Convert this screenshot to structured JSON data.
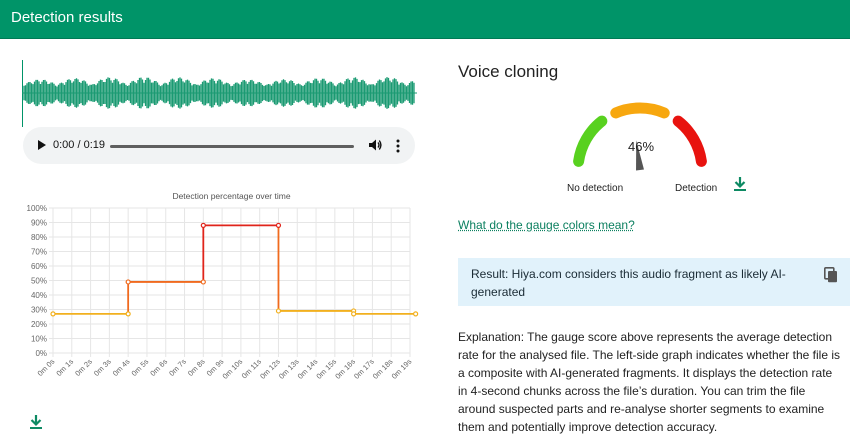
{
  "header": {
    "title": "Detection results"
  },
  "player": {
    "time": "0:00 / 0:19",
    "progress": 0
  },
  "icons": {
    "play": "play-icon",
    "volume": "volume-icon",
    "more": "more-vert-icon",
    "download": "download-icon",
    "copy": "copy-icon"
  },
  "colors": {
    "brand": "#009468",
    "waveform": "#1a9a72",
    "series_high": "#e0241b",
    "series_mid": "#f06a1e",
    "series_low": "#f2b01e",
    "result_bg": "#e1f2fb",
    "gauge_green": "#58d11f",
    "gauge_orange": "#f7a70f",
    "gauge_red": "#e8130f"
  },
  "chart_data": {
    "type": "line",
    "title": "Detection percentage over time",
    "xlabel": "",
    "ylabel": "",
    "ylim": [
      0,
      100
    ],
    "y_ticks": [
      "0%",
      "10%",
      "20%",
      "30%",
      "40%",
      "50%",
      "60%",
      "70%",
      "80%",
      "90%",
      "100%"
    ],
    "categories": [
      "0m 0s",
      "0m 1s",
      "0m 2s",
      "0m 3s",
      "0m 4s",
      "0m 5s",
      "0m 6s",
      "0m 7s",
      "0m 8s",
      "0m 9s",
      "0m 10s",
      "0m 11s",
      "0m 12s",
      "0m 13s",
      "0m 14s",
      "0m 15s",
      "0m 16s",
      "0m 17s",
      "0m 18s",
      "0m 19s"
    ],
    "grid": true,
    "series": [
      {
        "x": [
          0,
          4,
          4,
          8,
          8,
          12,
          12,
          16,
          16,
          19.3
        ],
        "values": [
          27,
          27,
          49,
          49,
          88,
          88,
          29,
          29,
          27,
          27
        ]
      }
    ]
  },
  "voice_cloning": {
    "title": "Voice cloning",
    "gauge_value": "46%",
    "gauge_level": 46,
    "label_left": "No detection",
    "label_right": "Detection",
    "link": "What do the gauge colors mean?",
    "result": "Result: Hiya.com considers this audio fragment as likely AI-generated",
    "explanation": "Explanation: The gauge score above represents the average detection rate for the analysed file. The left-side graph indicates whether the file is a composite with AI-generated fragments. It displays the detection rate in 4-second chunks across the file’s duration. You can trim the file around suspected parts and re-analyse shorter segments to examine them and potentially improve detection accuracy."
  }
}
